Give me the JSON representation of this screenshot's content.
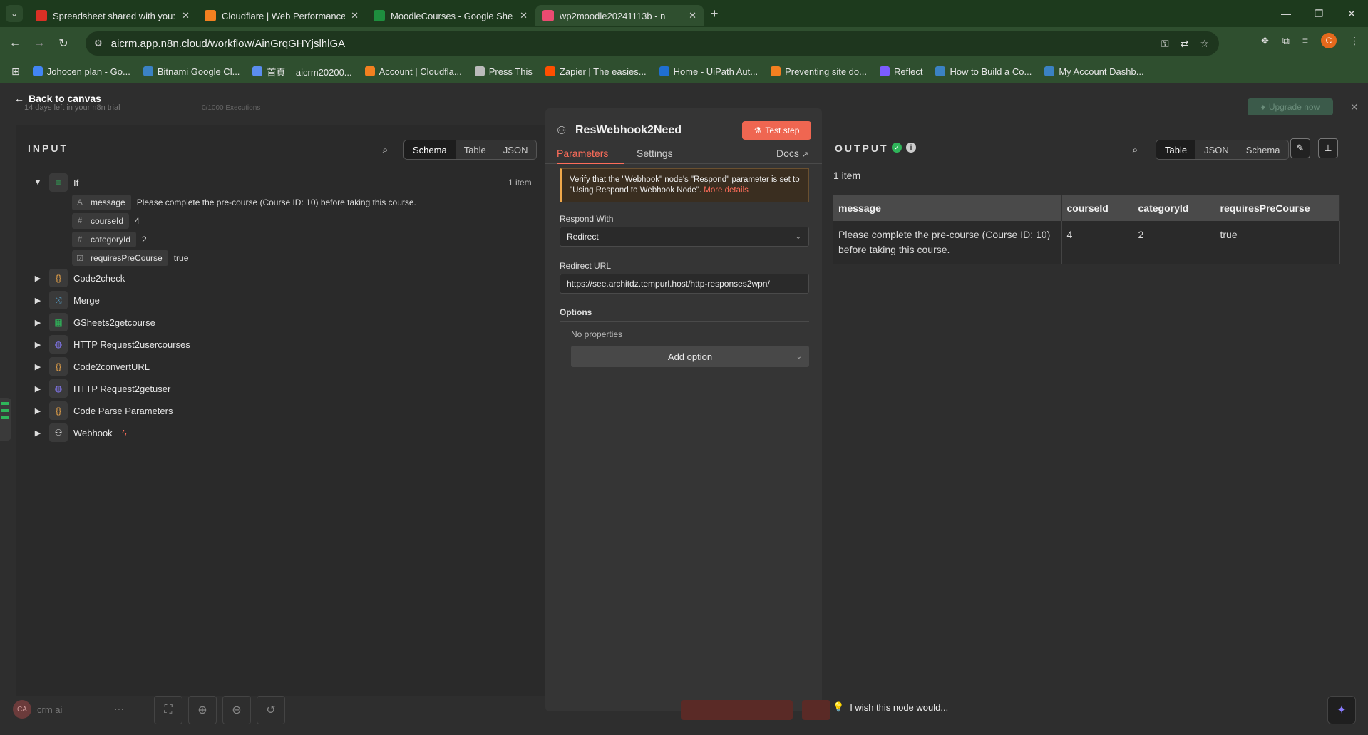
{
  "browser": {
    "tabs": [
      {
        "title": "Spreadsheet shared with you:",
        "icon": "gmail-icon",
        "color": "#d93025",
        "active": false
      },
      {
        "title": "Cloudflare | Web Performance",
        "icon": "cloudflare-icon",
        "color": "#f38020",
        "active": false
      },
      {
        "title": "MoodleCourses - Google She",
        "icon": "sheets-icon",
        "color": "#1e8e3e",
        "active": false
      },
      {
        "title": "wp2moodle20241113b - n",
        "icon": "n8n-icon",
        "color": "#ea4b71",
        "active": true
      }
    ],
    "url": "aicrm.app.n8n.cloud/workflow/AinGrqGHYjslhlGA",
    "profile_initial": "C",
    "bookmarks": [
      {
        "label": "Johocen plan - Go...",
        "color": "#4285f4"
      },
      {
        "label": "Bitnami Google Cl...",
        "color": "#3b82c4"
      },
      {
        "label": "首頁 – aicrm20200...",
        "color": "#5b8def"
      },
      {
        "label": "Account | Cloudfla...",
        "color": "#f38020"
      },
      {
        "label": "Press This",
        "color": "#bbbbbb"
      },
      {
        "label": "Zapier | The easies...",
        "color": "#ff4f00"
      },
      {
        "label": "Home - UiPath Aut...",
        "color": "#1f6fd1"
      },
      {
        "label": "Preventing site do...",
        "color": "#f38020"
      },
      {
        "label": "Reflect",
        "color": "#7b5cff"
      },
      {
        "label": "How to Build a Co...",
        "color": "#3b82c4"
      },
      {
        "label": "My Account Dashb...",
        "color": "#3b82c4"
      }
    ]
  },
  "app": {
    "back_label": "Back to canvas",
    "trial_text": "14 days left in your n8n trial",
    "executions_text": "0/1000 Executions",
    "upgrade_label": "Upgrade now",
    "input": {
      "title": "INPUT",
      "views": [
        "Schema",
        "Table",
        "JSON"
      ],
      "active_view": "Schema",
      "root_node": "If",
      "item_count": "1 item",
      "fields": [
        {
          "type": "A",
          "name": "message",
          "value": "Please complete the pre-course (Course ID: 10) before taking this course."
        },
        {
          "type": "#",
          "name": "courseId",
          "value": "4"
        },
        {
          "type": "#",
          "name": "categoryId",
          "value": "2"
        },
        {
          "type": "☑",
          "name": "requiresPreCourse",
          "value": "true"
        }
      ],
      "nodes": [
        {
          "name": "Code2check",
          "icon": "{}",
          "icon_color": "#f0a84a"
        },
        {
          "name": "Merge",
          "icon": "⤨",
          "icon_color": "#5ab0e0"
        },
        {
          "name": "GSheets2getcourse",
          "icon": "▦",
          "icon_color": "#2fb55a"
        },
        {
          "name": "HTTP Request2usercourses",
          "icon": "◍",
          "icon_color": "#8a7cff"
        },
        {
          "name": "Code2convertURL",
          "icon": "{}",
          "icon_color": "#f0a84a"
        },
        {
          "name": "HTTP Request2getuser",
          "icon": "◍",
          "icon_color": "#8a7cff"
        },
        {
          "name": "Code Parse Parameters",
          "icon": "{}",
          "icon_color": "#f0a84a"
        },
        {
          "name": "Webhook",
          "icon": "⚇",
          "icon_color": "#dddddd"
        }
      ]
    },
    "node": {
      "title": "ResWebhook2Need",
      "test_label": "Test step",
      "tabs": {
        "parameters": "Parameters",
        "settings": "Settings",
        "docs": "Docs"
      },
      "notice_text": "Verify that the \"Webhook\" node's \"Respond\" parameter is set to \"Using Respond to Webhook Node\".",
      "notice_link": "More details",
      "respond_label": "Respond With",
      "respond_value": "Redirect",
      "redirect_label": "Redirect URL",
      "redirect_value": "https://see.architdz.tempurl.host/http-responses2wpn/",
      "options_label": "Options",
      "no_properties": "No properties",
      "add_option": "Add option"
    },
    "output": {
      "title": "OUTPUT",
      "views": [
        "Table",
        "JSON",
        "Schema"
      ],
      "active_view": "Table",
      "item_count": "1 item",
      "columns": [
        "message",
        "courseId",
        "categoryId",
        "requiresPreCourse"
      ],
      "rows": [
        [
          "Please complete the pre-course (Course ID: 10) before taking this course.",
          "4",
          "2",
          "true"
        ]
      ]
    },
    "footer": {
      "user_initials": "CA",
      "user_name": "crm ai",
      "wish_text": "I wish this node would..."
    }
  }
}
